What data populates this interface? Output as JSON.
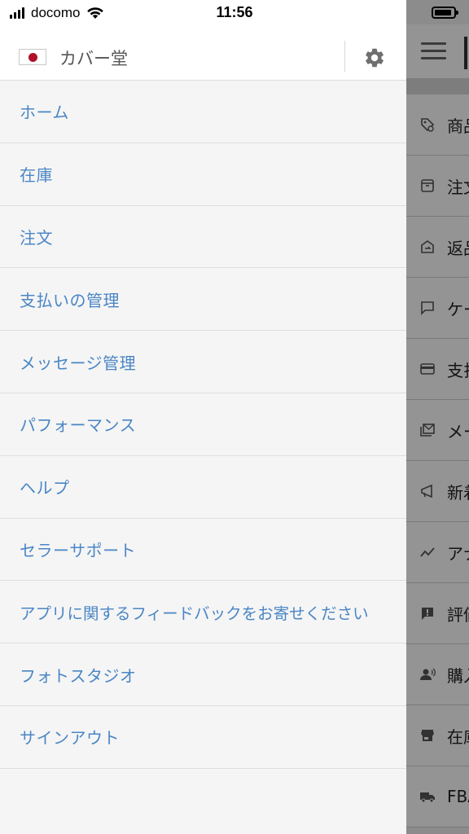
{
  "status_bar": {
    "carrier": "docomo",
    "time": "11:56"
  },
  "drawer": {
    "store_name": "カバー堂",
    "flag_icon": "japan-flag-icon",
    "settings_icon": "gear-icon",
    "menu_items": [
      {
        "label": "ホーム"
      },
      {
        "label": "在庫"
      },
      {
        "label": "注文"
      },
      {
        "label": "支払いの管理"
      },
      {
        "label": "メッセージ管理"
      },
      {
        "label": "パフォーマンス"
      },
      {
        "label": "ヘルプ"
      },
      {
        "label": "セラーサポート"
      },
      {
        "label": "アプリに関するフィードバックをお寄せください"
      },
      {
        "label": "フォトスタジオ"
      },
      {
        "label": "サインアウト"
      }
    ],
    "link_color": "#4a86c5"
  },
  "background_app": {
    "rows": [
      {
        "label": "商品",
        "icon": "tag-icon"
      },
      {
        "label": "注文",
        "icon": "box-icon"
      },
      {
        "label": "返品",
        "icon": "return-icon"
      },
      {
        "label": "ケー",
        "icon": "chat-icon"
      },
      {
        "label": "支払",
        "icon": "card-icon"
      },
      {
        "label": "メー",
        "icon": "mail-icon"
      },
      {
        "label": "新着",
        "icon": "megaphone-icon"
      },
      {
        "label": "アナ",
        "icon": "trend-icon"
      },
      {
        "label": "評価",
        "icon": "feedback-icon"
      },
      {
        "label": "購入",
        "icon": "buyer-icon"
      },
      {
        "label": "在庫",
        "icon": "store-icon"
      },
      {
        "label": "FBA",
        "icon": "truck-icon"
      }
    ]
  }
}
